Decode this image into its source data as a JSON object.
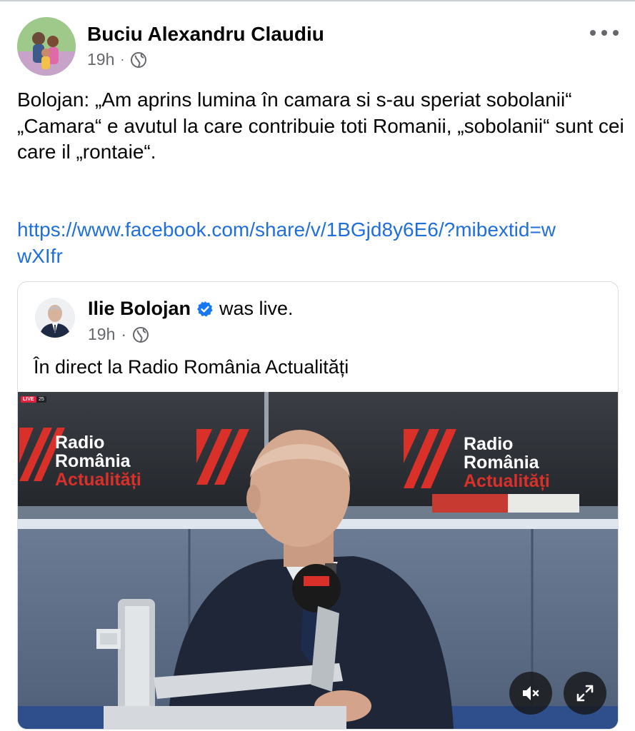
{
  "post": {
    "author": "Buciu Alexandru Claudiu",
    "time": "19h",
    "separator": "·",
    "text_lines": [
      "Bolojan: „Am aprins lumina în camara si s-au speriat sobolanii“",
      "„Camara“ e avutul la care contribuie toti Romanii, „sobolanii“ sunt cei care il „rontaie“."
    ],
    "link": "https://www.facebook.com/share/v/1BGjd8y6E6/?mibextid=wwXIfr"
  },
  "shared": {
    "author": "Ilie Bolojan",
    "action": "was live.",
    "time": "19h",
    "separator": "·",
    "title": "În direct la Radio România Actualități"
  },
  "video": {
    "live_label": "LIVE",
    "viewers": "25",
    "brand_lines": [
      "Radio",
      "România",
      "Actualități"
    ],
    "mic_label": "Radio România Actualități"
  },
  "icons": {
    "more": "more-horizontal-icon",
    "privacy": "globe-icon",
    "verified": "verified-badge-icon",
    "mute": "speaker-muted-icon",
    "fullscreen": "expand-icon"
  },
  "colors": {
    "link": "#216fdb",
    "verified": "#1877f2",
    "brand_red": "#d9302a",
    "secondary_text": "#65676b"
  }
}
